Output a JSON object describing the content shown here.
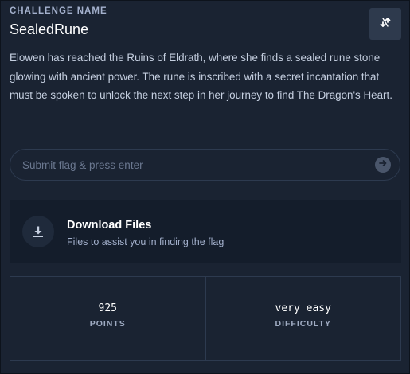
{
  "challenge": {
    "eyebrow": "CHALLENGE NAME",
    "name": "SealedRune",
    "description": "Elowen has reached the Ruins of Eldrath, where she finds a sealed rune stone glowing with ancient power. The rune is inscribed with a secret incantation that must be spoken to unlock the next step in her journey to find The Dragon's Heart.",
    "action_icon": "swap-arrows-icon"
  },
  "flag_input": {
    "placeholder": "Submit flag & press enter",
    "value": "",
    "submit_icon": "arrow-right-circle-icon"
  },
  "download": {
    "title": "Download Files",
    "subtitle": "Files to assist you in finding the flag",
    "icon": "download-icon"
  },
  "stats": {
    "points_value": "925",
    "points_label": "POINTS",
    "difficulty_value": "very easy",
    "difficulty_label": "DIFFICULTY"
  },
  "colors": {
    "background": "#1a2332",
    "card": "#141d2b",
    "border": "#2d3a4f",
    "muted_text": "#a4b1cd"
  }
}
